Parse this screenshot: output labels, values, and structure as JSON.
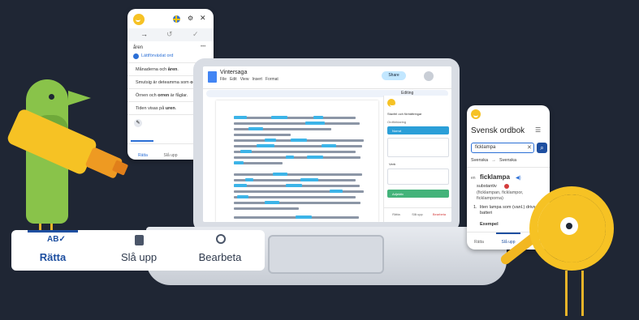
{
  "left_card": {
    "logo": "grammar-app-logo",
    "flag": "swedish-flag",
    "word_top": "åren",
    "suggest_label": "Lättförväxlat ord",
    "rows": [
      {
        "pre": "Månaderna och ",
        "bold": "åren",
        "post": "."
      },
      {
        "pre": "Smutsig är deteamma som ",
        "bold": "o",
        "post": ""
      },
      {
        "pre": "Örnen och ",
        "bold": "orren",
        "post": " är fåglar."
      },
      {
        "pre": "Tiden visas på ",
        "bold": "uren",
        "post": "."
      }
    ],
    "tab_rata": "Rätta",
    "tab_sla_upp": "Slå upp",
    "tab_bearb": "Bearb"
  },
  "laptop": {
    "doc_title": "Vintersaga",
    "menu": [
      "File",
      "Edit",
      "View",
      "Insert",
      "Format"
    ],
    "share_label": "Share",
    "editing_label": "Editing",
    "side_tabs": [
      "Rätta",
      "Slå upp",
      "Bearbeta"
    ],
    "side_heading": "Stavfel och förbättringar",
    "side_items": [
      "Ordförklaring",
      "Norrut",
      "Verb",
      "Adjektiv"
    ]
  },
  "dict_card": {
    "title": "Svensk ordbok",
    "search_value": "ficklampa",
    "lang_from": "Svenska",
    "lang_to": "Svenska",
    "entry_prefix": "en",
    "headword": "ficklampa",
    "pos": "substantiv",
    "forms": "(ficklampan, ficklampor, ficklamporna)",
    "sense_num": "1.",
    "sense": "liten lampa som (vanl.) drivs av batteri",
    "example_label": "Exempel",
    "tab_left": "Rätta",
    "tab_active": "Slå upp",
    "tab_right": "Bearb"
  },
  "bottom_nav": {
    "items": [
      {
        "label": "Rätta",
        "icon": "spellcheck-icon",
        "active": true
      },
      {
        "label": "Slå upp",
        "icon": "book-icon",
        "active": false
      },
      {
        "label": "Bearbeta",
        "icon": "magnify-text-icon",
        "active": false
      }
    ]
  },
  "colors": {
    "background": "#1f2634",
    "brand_yellow": "#f6c224",
    "highlight_blue": "#3cb4e8",
    "bird_green": "#89c34a",
    "active_blue": "#1e4fa0"
  }
}
